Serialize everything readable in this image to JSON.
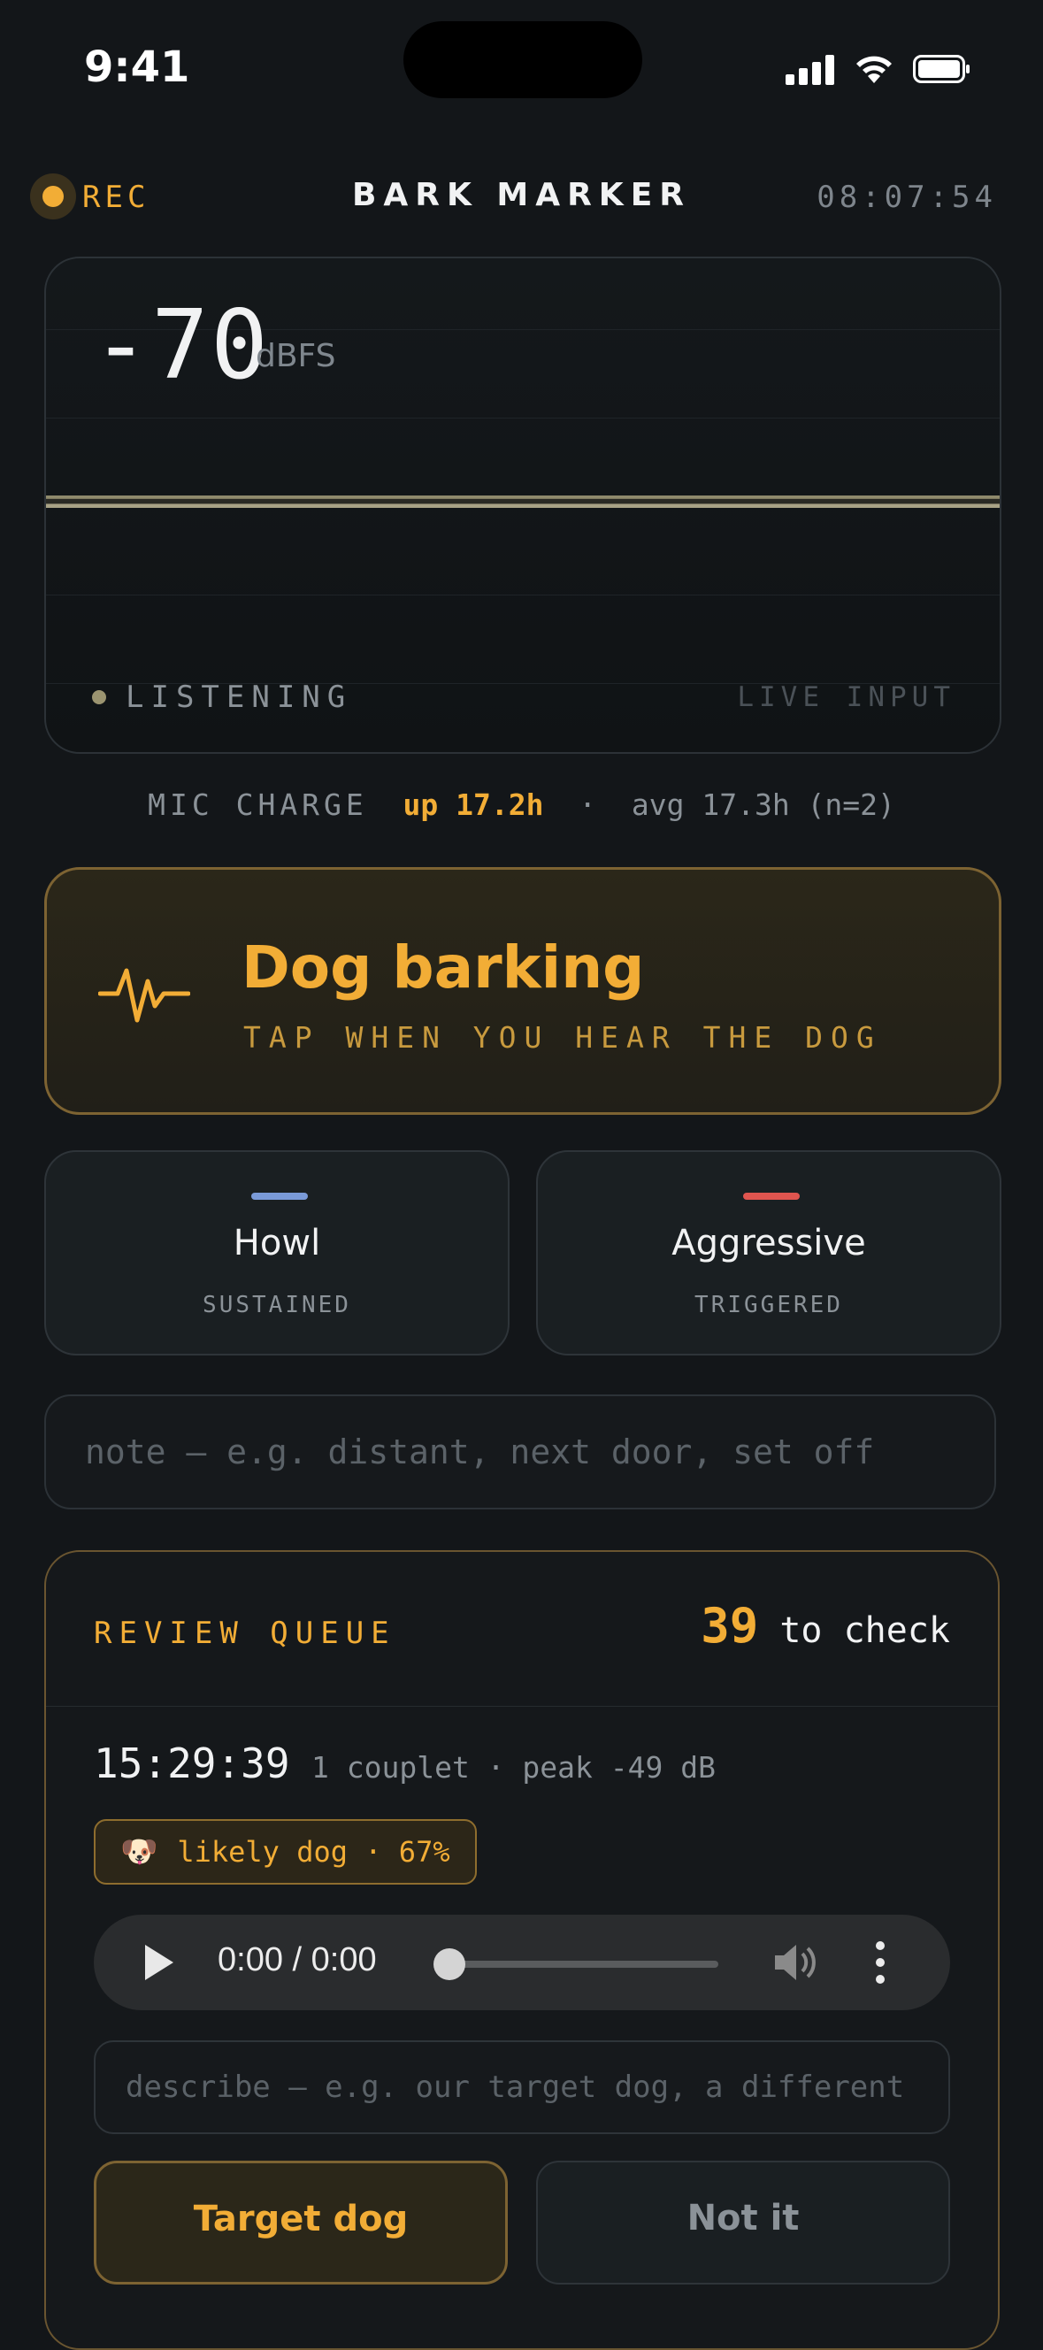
{
  "status_bar": {
    "time": "9:41"
  },
  "header": {
    "rec_label": "REC",
    "title": "BARK MARKER",
    "clock": "08:07:54"
  },
  "meter": {
    "level_value": "-70",
    "level_unit": "dBFS",
    "state_label": "LISTENING",
    "source_label": "LIVE INPUT"
  },
  "mic": {
    "label": "MIC CHARGE",
    "uptime": "up 17.2h",
    "separator": "·",
    "average": "avg 17.3h (n=2)"
  },
  "bark_button": {
    "title": "Dog barking",
    "subtitle": "TAP WHEN YOU HEAR THE DOG"
  },
  "types": [
    {
      "title": "Howl",
      "subtitle": "SUSTAINED",
      "color": "#7a9ad8"
    },
    {
      "title": "Aggressive",
      "subtitle": "TRIGGERED",
      "color": "#e0554f"
    }
  ],
  "note": {
    "placeholder": "note — e.g. distant, next door, set off",
    "value": ""
  },
  "review_queue": {
    "title": "REVIEW QUEUE",
    "count": "39",
    "count_suffix": "to check",
    "event": {
      "time": "15:29:39",
      "meta": "1 couplet · peak -49 dB",
      "badge_emoji": "🐶",
      "badge_text": "likely dog · 67%",
      "player_time": "0:00 / 0:00",
      "describe_placeholder": "describe — e.g. our target dog, a different"
    },
    "buttons": {
      "target": "Target dog",
      "not_it": "Not it"
    }
  },
  "colors": {
    "accent": "#f2ad36",
    "background": "#131619"
  }
}
